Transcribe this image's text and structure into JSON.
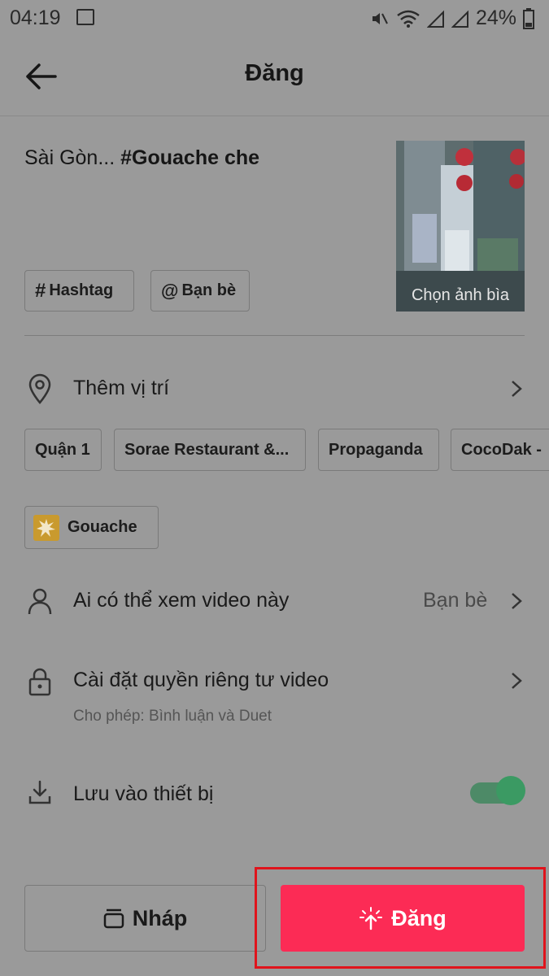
{
  "status_bar": {
    "time": "04:19",
    "battery": "24%"
  },
  "header": {
    "title": "Đăng"
  },
  "post": {
    "caption_prefix": "Sài Gòn... ",
    "caption_hashtag": "#Gouache che",
    "cover_label": "Chọn ảnh bìa"
  },
  "tag_buttons": {
    "hashtag": "Hashtag",
    "friends": "Bạn bè"
  },
  "location": {
    "label": "Thêm vị trí",
    "suggestions": [
      "Quận 1",
      "Sorae Restaurant &...",
      "Propaganda",
      "CocoDak -"
    ]
  },
  "effect": {
    "label": "Gouache"
  },
  "visibility": {
    "label": "Ai có thể xem video này",
    "value": "Bạn bè"
  },
  "privacy": {
    "label": "Cài đặt quyền riêng tư video",
    "sub": "Cho phép: Bình luận và Duet"
  },
  "save": {
    "label": "Lưu vào thiết bị",
    "enabled": true
  },
  "actions": {
    "draft_label": "Nháp",
    "post_label": "Đăng"
  },
  "colors": {
    "post_button": "#fc2b55",
    "toggle": "#3b9a63",
    "highlight": "#e0141c"
  }
}
